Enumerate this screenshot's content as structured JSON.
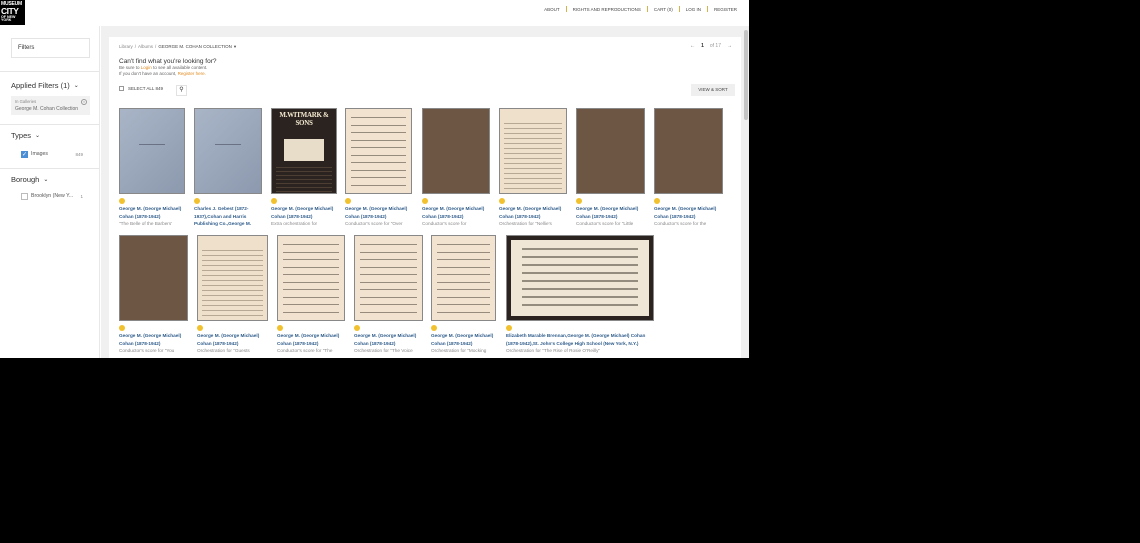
{
  "logo": {
    "line1": "MUSEUM",
    "line2": "CITY",
    "line3": "OF NEW YORK"
  },
  "topnav": [
    "ABOUT",
    "RIGHTS AND REPRODUCTIONS",
    "CART (0)",
    "LOG IN",
    "REGISTER"
  ],
  "sidebar": {
    "filter_label": "Filters",
    "applied_heading": "Applied Filters (1)",
    "applied_key": "In Galleries",
    "applied_value": "George M. Cohan Collection",
    "types_heading": "Types",
    "types": [
      {
        "label": "Images",
        "count": "849",
        "checked": true
      }
    ],
    "borough_heading": "Borough",
    "boroughs": [
      {
        "label": "Brooklyn (New Y...",
        "count": "1"
      }
    ]
  },
  "breadcrumbs": [
    "Library",
    "/",
    "Albums",
    "/",
    "GEORGE M. COHAN COLLECTION"
  ],
  "pager": {
    "page": "1",
    "of": "of 17"
  },
  "notice": {
    "heading": "Can't find what you're looking for?",
    "line1_pre": "Be sure to",
    "line1_link": "Login",
    "line1_post": "to see all available content.",
    "line2_pre": "If you don't have an account,",
    "line2_link": "Register here."
  },
  "select_all_label": "SELECT ALL 849",
  "view_sort_label": "VIEW & SORT",
  "results": [
    {
      "title": "George M. (George Michael) Cohan (1878-1942)",
      "desc": "\"The Belle of the Barbers'",
      "thumb": "blue"
    },
    {
      "title": "Charles J. Gebest (1872-1937),Cohan and Harris Publishing Co.,George M.",
      "desc": "",
      "thumb": "blue"
    },
    {
      "title": "George M. (George Michael) Cohan (1878-1942)",
      "desc": "Extra orchestration for",
      "thumb": "witmark",
      "cover_text": "M.WITMARK & SONS"
    },
    {
      "title": "George M. (George Michael) Cohan (1878-1942)",
      "desc": "Conductor's score for \"Over",
      "thumb": "score"
    },
    {
      "title": "George M. (George Michael) Cohan (1878-1942)",
      "desc": "Conductor's score for",
      "thumb": "brown"
    },
    {
      "title": "George M. (George Michael) Cohan (1878-1942)",
      "desc": "Orchestration for \"Nellie's",
      "thumb": "staff"
    },
    {
      "title": "George M. (George Michael) Cohan (1878-1942)",
      "desc": "Conductor's score for \"Little",
      "thumb": "brown"
    },
    {
      "title": "George M. (George Michael) Cohan (1878-1942)",
      "desc": "Conductor's score for the",
      "thumb": "brown"
    },
    {
      "title": "George M. (George Michael) Cohan (1878-1942)",
      "desc": "Conductor's score for \"You",
      "thumb": "brown"
    },
    {
      "title": "George M. (George Michael) Cohan (1878-1942)",
      "desc": "Orchestration for \"Guests",
      "thumb": "staff"
    },
    {
      "title": "George M. (George Michael) Cohan (1878-1942)",
      "desc": "Conductor's score for \"The",
      "thumb": "score"
    },
    {
      "title": "George M. (George Michael) Cohan (1878-1942)",
      "desc": "Orchestration for \"The Voice",
      "thumb": "score"
    },
    {
      "title": "George M. (George Michael) Cohan (1878-1942)",
      "desc": "Orchestration for \"Mocking",
      "thumb": "score"
    },
    {
      "title": "Elizabeth Marable Brennan,George M. (George Michael) Cohan (1878-1942),St. John's College High School (New York, N.Y.)",
      "desc": "Orchestration for \"The Rise of Rosie O'Reilly\"",
      "thumb": "dark"
    }
  ],
  "colors": {
    "link": "#2e5b8a",
    "accent": "#e08a1e",
    "badge": "#f2c12e",
    "checkbox": "#4a8fd6"
  }
}
